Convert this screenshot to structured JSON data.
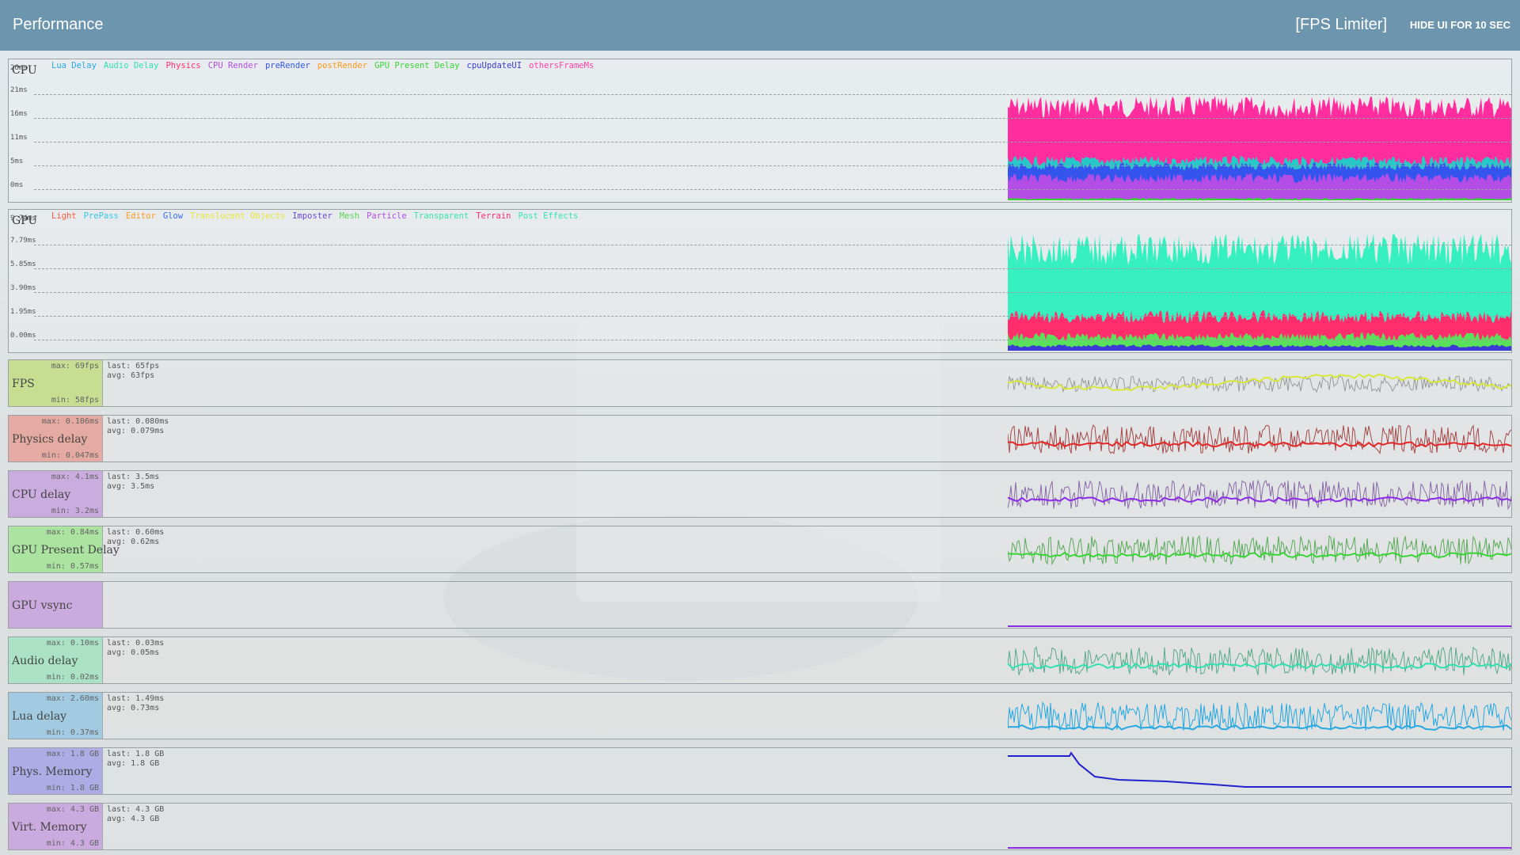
{
  "header": {
    "title": "Performance",
    "fps_limiter": "[FPS Limiter]",
    "hide_ui": "HIDE UI FOR 10 SEC"
  },
  "cpu_panel": {
    "title": "CPU",
    "legend": [
      {
        "label": "Lua Delay",
        "color": "#27a8e0"
      },
      {
        "label": "Audio Delay",
        "color": "#2fe0b0"
      },
      {
        "label": "Physics",
        "color": "#ff2d6b"
      },
      {
        "label": "CPU Render",
        "color": "#b34de6"
      },
      {
        "label": "preRender",
        "color": "#3355ee"
      },
      {
        "label": "postRender",
        "color": "#ff9a1a"
      },
      {
        "label": "GPU Present Delay",
        "color": "#38d436"
      },
      {
        "label": "cpuUpdateUI",
        "color": "#3a3ad4"
      },
      {
        "label": "othersFrameMs",
        "color": "#ff3fa5"
      }
    ],
    "ticks": [
      "26ms",
      "21ms",
      "16ms",
      "11ms",
      "5ms",
      "0ms"
    ]
  },
  "gpu_panel": {
    "title": "GPU",
    "legend": [
      {
        "label": "Light",
        "color": "#ff5a3a"
      },
      {
        "label": "PrePass",
        "color": "#36c8e6"
      },
      {
        "label": "Editor",
        "color": "#ff9a1a"
      },
      {
        "label": "Glow",
        "color": "#3a6ee6"
      },
      {
        "label": "Translucent Objects",
        "color": "#e8e834"
      },
      {
        "label": "Imposter",
        "color": "#6a4ad6"
      },
      {
        "label": "Mesh",
        "color": "#5ad65a"
      },
      {
        "label": "Particle",
        "color": "#b34de6"
      },
      {
        "label": "Transparent",
        "color": "#36e6a0"
      },
      {
        "label": "Terrain",
        "color": "#ff2d6b"
      },
      {
        "label": "Post Effects",
        "color": "#36e6b0"
      }
    ],
    "ticks": [
      "9.74ms",
      "7.79ms",
      "5.85ms",
      "3.90ms",
      "1.95ms",
      "0.00ms"
    ]
  },
  "metrics": [
    {
      "name": "FPS",
      "max": "max: 69fps",
      "min": "min: 58fps",
      "last": "last: 65fps",
      "avg": "avg: 63fps",
      "bg": "#c5dd8a",
      "line": "#d8e83a",
      "noise": "#9a9a9a"
    },
    {
      "name": "Physics delay",
      "max": "max: 0.106ms",
      "min": "min: 0.047ms",
      "last": "last: 0.080ms",
      "avg": "avg: 0.079ms",
      "bg": "#e6a49a",
      "line": "#e32626",
      "noise": "#a34a4a"
    },
    {
      "name": "CPU delay",
      "max": "max: 4.1ms",
      "min": "min: 3.2ms",
      "last": "last: 3.5ms",
      "avg": "avg: 3.5ms",
      "bg": "#c9a6df",
      "line": "#8a2ae6",
      "noise": "#8a6aa8"
    },
    {
      "name": "GPU Present Delay",
      "max": "max: 0.84ms",
      "min": "min: 0.57ms",
      "last": "last: 0.60ms",
      "avg": "avg: 0.62ms",
      "bg": "#a6e39a",
      "line": "#38d436",
      "noise": "#5aaa5a"
    },
    {
      "name": "GPU vsync",
      "max": "",
      "min": "",
      "last": "",
      "avg": "",
      "bg": "#c9a6df",
      "line": "#8a2ae6",
      "noise": ""
    },
    {
      "name": "Audio delay",
      "max": "max: 0.10ms",
      "min": "min: 0.02ms",
      "last": "last: 0.03ms",
      "avg": "avg: 0.05ms",
      "bg": "#a6e3c4",
      "line": "#2fe0b0",
      "noise": "#5aa88a"
    },
    {
      "name": "Lua delay",
      "max": "max: 2.60ms",
      "min": "min: 0.37ms",
      "last": "last: 1.49ms",
      "avg": "avg: 0.73ms",
      "bg": "#9cc9e3",
      "line": "#27a8e0",
      "noise": "#27a8e0"
    },
    {
      "name": "Phys. Memory",
      "max": "max: 1.8 GB",
      "min": "min: 1.8 GB",
      "last": "last: 1.8 GB",
      "avg": "avg: 1.8 GB",
      "bg": "#a9a6e6",
      "line": "#2222cc",
      "noise": ""
    },
    {
      "name": "Virt. Memory",
      "max": "max: 4.3 GB",
      "min": "min: 4.3 GB",
      "last": "last: 4.3 GB",
      "avg": "avg: 4.3 GB",
      "bg": "#c9a6df",
      "line": "#8a2ae6",
      "noise": ""
    }
  ]
}
